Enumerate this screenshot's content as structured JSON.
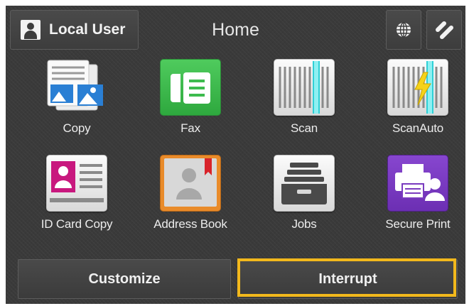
{
  "header": {
    "user_label": "Local User",
    "title": "Home",
    "user_icon": "user-icon",
    "globe_icon": "globe-icon",
    "tools_icon": "tools-icon"
  },
  "apps": [
    {
      "label": "Copy",
      "icon": "copy-icon"
    },
    {
      "label": "Fax",
      "icon": "fax-icon"
    },
    {
      "label": "Scan",
      "icon": "scan-icon"
    },
    {
      "label": "ScanAuto",
      "icon": "scan-auto-icon"
    },
    {
      "label": "ID Card Copy",
      "icon": "id-card-icon"
    },
    {
      "label": "Address Book",
      "icon": "address-book-icon"
    },
    {
      "label": "Jobs",
      "icon": "jobs-icon"
    },
    {
      "label": "Secure Print",
      "icon": "secure-print-icon"
    }
  ],
  "bottom": {
    "customize_label": "Customize",
    "interrupt_label": "Interrupt"
  },
  "colors": {
    "background": "#3a3a3a",
    "fax_green": "#3dbb4e",
    "secure_print_purple": "#7a3bbf",
    "scan_cyan": "#2fd0d6",
    "highlight": "#f2b81c"
  }
}
